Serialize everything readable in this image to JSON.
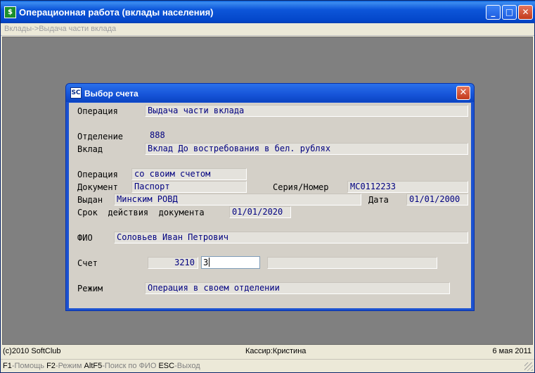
{
  "window": {
    "title": "Операционная работа (вклады населения)",
    "breadcrumb": "Вклады->Выдача части вклада",
    "minimize": "_",
    "maximize": "□",
    "close": "✕"
  },
  "dialog": {
    "title": "Выбор счета",
    "icon_text": "SC",
    "close": "✕",
    "fields": {
      "operation_label": "Операция",
      "operation_value": "Выдача части вклада",
      "branch_label": "Отделение",
      "branch_value": "888",
      "deposit_label": "Вклад",
      "deposit_value": "Вклад До востребования в бел. рублях",
      "op2_label": "Операция",
      "op2_value": "со своим счетом",
      "document_label": "Документ",
      "document_value": "Паспорт",
      "series_label": "Серия/Номер",
      "series_value": "МС0112233",
      "issued_label": "Выдан",
      "issued_value": "Минским РОВД",
      "date_label": "Дата",
      "date_value": "01/01/2000",
      "validity_label": "Срок  действия  документа",
      "validity_value": "01/01/2020",
      "fio_label": "ФИО",
      "fio_value": "Соловьев Иван Петрович",
      "account_label": "Счет",
      "account_prefix": "3210",
      "account_input": "3",
      "mode_label": "Режим",
      "mode_value": "Операция в своем отделении"
    }
  },
  "status": {
    "copyright": "(c)2010 SoftClub",
    "cashier": "Кассир:Кристина",
    "date": "6 мая 2011"
  },
  "hotkeys": [
    {
      "key": "F1",
      "desc": "-Помощь"
    },
    {
      "key": "F2",
      "desc": "-Режим"
    },
    {
      "key": "AltF5",
      "desc": "-Поиск по ФИО"
    },
    {
      "key": "ESC",
      "desc": "-Выход"
    }
  ],
  "colors": {
    "titlebar": "#0346c9",
    "workspace": "#808080",
    "field_text": "#000080",
    "dialog_frame": "#1c52d0"
  }
}
